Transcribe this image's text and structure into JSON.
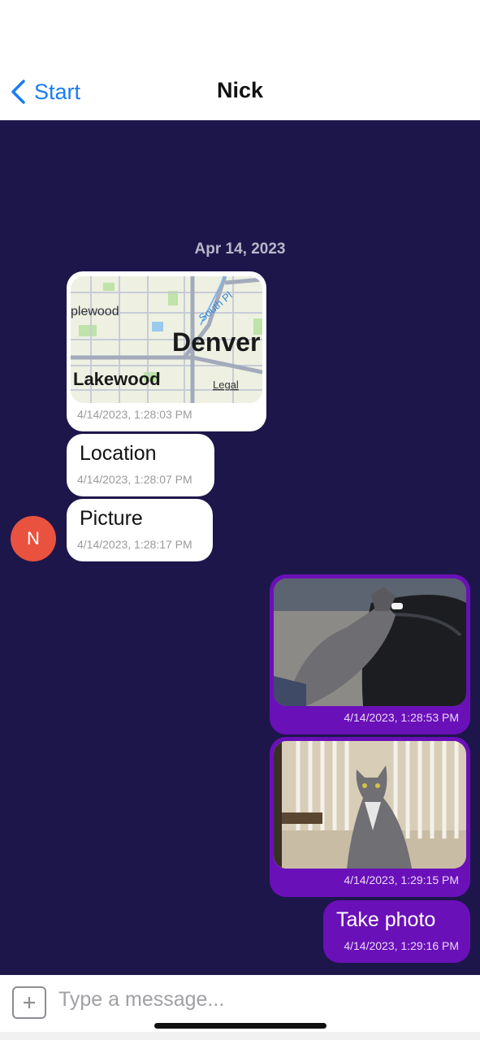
{
  "header": {
    "back_label": "Start",
    "title": "Nick"
  },
  "chat": {
    "date_separator": "Apr 14, 2023",
    "contact_avatar_initial": "N",
    "incoming": [
      {
        "type": "location",
        "map_labels": [
          "plewood",
          "Denver",
          "Lakewood",
          "South Pl",
          "Legal"
        ],
        "timestamp": "4/14/2023, 1:28:03 PM"
      },
      {
        "type": "text",
        "text": "Location",
        "timestamp": "4/14/2023, 1:28:07 PM"
      },
      {
        "type": "text",
        "text": "Picture",
        "timestamp": "4/14/2023, 1:28:17 PM"
      }
    ],
    "outgoing": [
      {
        "type": "image",
        "timestamp": "4/14/2023, 1:28:53 PM"
      },
      {
        "type": "image",
        "timestamp": "4/14/2023, 1:29:15 PM"
      },
      {
        "type": "text",
        "text": "Take photo",
        "timestamp": "4/14/2023, 1:29:16 PM"
      }
    ]
  },
  "composer": {
    "placeholder": "Type a message..."
  },
  "colors": {
    "accent": "#1a7cf3",
    "chat_background": "#1d164b",
    "outgoing_bubble": "#6a10b8",
    "avatar": "#e8523f"
  }
}
